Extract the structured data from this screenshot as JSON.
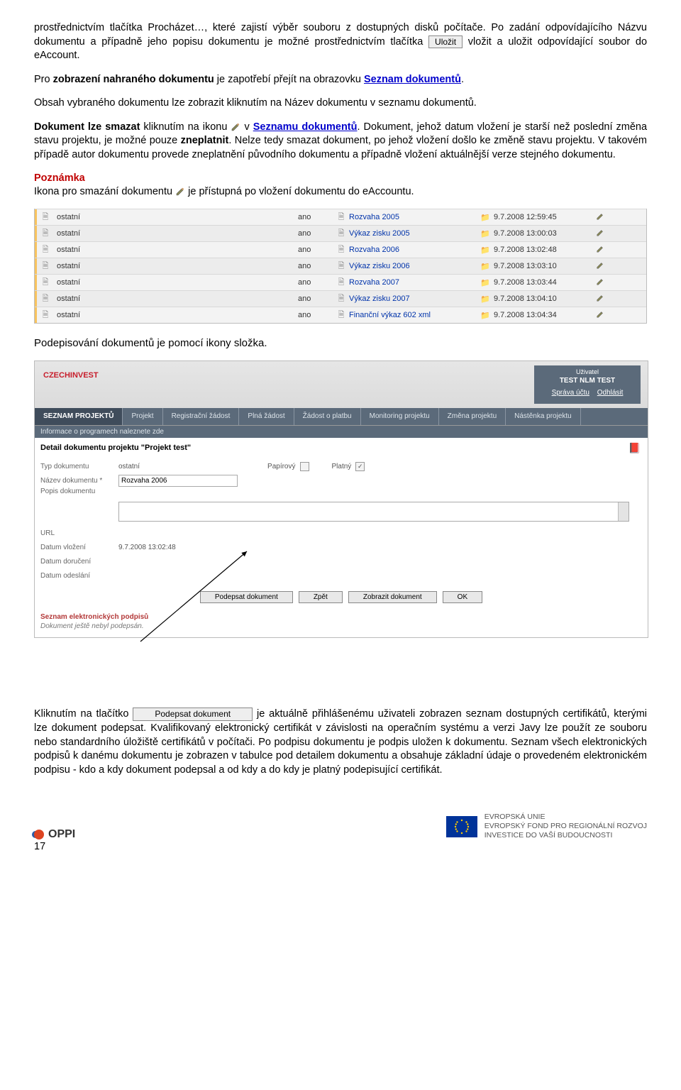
{
  "intro": {
    "p1a": "prostřednictvím tlačítka Procházet…, které zajistí výběr souboru z dostupných disků počítače. Po zadání odpovídajícího Názvu dokumentu a případně jeho popisu dokumentu je možné prostřednictvím tlačítka ",
    "btn1": "Uložit",
    "p1b": " vložit a uložit odpovídající soubor do eAccount.",
    "p2a": "Pro ",
    "p2b": "zobrazení nahraného dokumentu",
    "p2c": " je zapotřebí přejít na obrazovku ",
    "p2link": "Seznam dokumentů",
    "p2d": ".",
    "p3": "Obsah vybraného dokumentu lze zobrazit kliknutím na Název dokumentu v seznamu dokumentů.",
    "p4a": "Dokument lze smazat",
    "p4b": " kliknutím na ikonu ",
    "p4c": " v ",
    "p4link": "Seznamu dokumentů",
    "p4d": ". Dokument, jehož datum vložení je starší než poslední změna stavu projektu, je možné pouze ",
    "p4e": "zneplatnit",
    "p4f": ". Nelze tedy smazat dokument, po jehož vložení došlo ke změně stavu projektu. V takovém případě autor dokumentu provede zneplatnění původního dokumentu a případně vložení aktuálnější verze stejného dokumentu.",
    "note_title": "Poznámka",
    "note_a": "Ikona pro smazání dokumentu ",
    "note_b": " je přístupná po vložení dokumentu do eAccountu."
  },
  "table_rows": [
    {
      "type": "ostatní",
      "ano": "ano",
      "name": "Rozvaha 2005",
      "date": "9.7.2008 12:59:45"
    },
    {
      "type": "ostatní",
      "ano": "ano",
      "name": "Výkaz zisku 2005",
      "date": "9.7.2008 13:00:03"
    },
    {
      "type": "ostatní",
      "ano": "ano",
      "name": "Rozvaha 2006",
      "date": "9.7.2008 13:02:48"
    },
    {
      "type": "ostatní",
      "ano": "ano",
      "name": "Výkaz zisku 2006",
      "date": "9.7.2008 13:03:10"
    },
    {
      "type": "ostatní",
      "ano": "ano",
      "name": "Rozvaha 2007",
      "date": "9.7.2008 13:03:44"
    },
    {
      "type": "ostatní",
      "ano": "ano",
      "name": "Výkaz zisku 2007",
      "date": "9.7.2008 13:04:10"
    },
    {
      "type": "ostatní",
      "ano": "ano",
      "name": "Finanční výkaz 602 xml",
      "date": "9.7.2008 13:04:34"
    }
  ],
  "mid_line": "Podepisování dokumentů je pomocí ikony složka.",
  "app": {
    "logo": "CZECHINVEST",
    "userbox": {
      "label": "Uživatel",
      "name": "TEST NLM TEST",
      "link1": "Správa účtu",
      "link2": "Odhlásit"
    },
    "tabs": [
      "SEZNAM PROJEKTŮ",
      "Projekt",
      "Registrační žádost",
      "Plná žádost",
      "Žádost o platbu",
      "Monitoring projektu",
      "Změna projektu",
      "Nástěnka projektu"
    ],
    "infobar": "Informace o programech naleznete zde",
    "detail_title": "Detail dokumentu projektu  \"Projekt test\"",
    "form": {
      "typ_l": "Typ dokumentu",
      "typ_v": "ostatní",
      "pap": "Papírový",
      "pla": "Platný",
      "naz_l": "Název dokumentu *",
      "naz_v": "Rozvaha 2006",
      "pop_l": "Popis dokumentu",
      "url_l": "URL",
      "dv_l": "Datum vložení",
      "dv_v": "9.7.2008 13:02:48",
      "dd_l": "Datum doručení",
      "do_l": "Datum odeslání"
    },
    "buttons": [
      "Podepsat dokument",
      "Zpět",
      "Zobrazit dokument",
      "OK"
    ],
    "sig_title": "Seznam elektronických podpisů",
    "sig_note": "Dokument ještě nebyl podepsán."
  },
  "final": {
    "a": "Kliknutím na tlačítko ",
    "btn": "Podepsat dokument",
    "b": " je aktuálně přihlášenému uživateli zobrazen seznam dostupných certifikátů, kterými lze dokument podepsat. Kvalifikovaný elektronický certifikát v závislosti na operačním systému a verzi Javy lze použít ze souboru nebo standardního úložiště certifikátů v počítači. Po podpisu dokumentu je podpis uložen k dokumentu. Seznam všech elektronických podpisů k danému dokumentu je zobrazen v tabulce pod detailem dokumentu a obsahuje základní údaje o provedeném elektronickém podpisu - kdo a kdy dokument podepsal a od kdy a do kdy je platný podepisující certifikát."
  },
  "footer": {
    "oppi": "OPPI",
    "page": "17",
    "eu1": "EVROPSKÁ UNIE",
    "eu2": "EVROPSKÝ FOND PRO REGIONÁLNÍ ROZVOJ",
    "eu3": "INVESTICE DO VAŠÍ BUDOUCNOSTI"
  }
}
